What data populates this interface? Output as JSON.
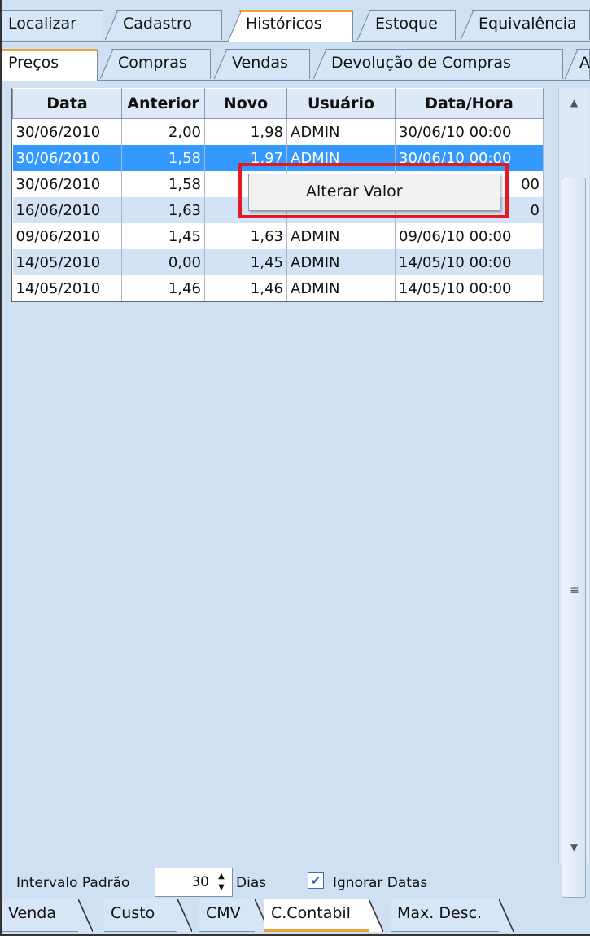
{
  "top_tabs": [
    "Localizar",
    "Cadastro",
    "Históricos",
    "Estoque",
    "Equivalência"
  ],
  "active_top_tab": "Históricos",
  "sub_tabs": [
    "Preços",
    "Compras",
    "Vendas",
    "Devolução de Compras",
    "A"
  ],
  "active_sub_tab": "Preços",
  "table": {
    "headers": [
      "Data",
      "Anterior",
      "Novo",
      "Usuário",
      "Data/Hora"
    ],
    "rows": [
      [
        "30/06/2010",
        "2,00",
        "1,98",
        "ADMIN",
        "30/06/10 00:00"
      ],
      [
        "30/06/2010",
        "1,58",
        "1,97",
        "ADMIN",
        "30/06/10 00:00"
      ],
      [
        "30/06/2010",
        "1,58",
        "",
        "",
        "00"
      ],
      [
        "16/06/2010",
        "1,63",
        "",
        "",
        "0"
      ],
      [
        "09/06/2010",
        "1,45",
        "1,63",
        "ADMIN",
        "09/06/10 00:00"
      ],
      [
        "14/05/2010",
        "0,00",
        "1,45",
        "ADMIN",
        "14/05/10 00:00"
      ],
      [
        "14/05/2010",
        "1,46",
        "1,46",
        "ADMIN",
        "14/05/10 00:00"
      ]
    ],
    "selected_row": 1
  },
  "context_menu": {
    "items": [
      "Alterar Valor"
    ]
  },
  "scrollbar": {
    "up_icon": "triangle-up-icon",
    "down_icon": "triangle-down-icon",
    "grip_icon": "grip-icon"
  },
  "controls": {
    "intervalo_label": "Intervalo Padrão",
    "intervalo_value": "30",
    "dias_label": "Dias",
    "ignorar_datas_label": "Ignorar Datas",
    "ignorar_datas_checked": true
  },
  "bottom_tabs": [
    "Venda",
    "Custo",
    "CMV",
    "C.Contabil",
    "Max. Desc."
  ],
  "active_bottom_tab": "C.Contabil",
  "colors": {
    "selection": "#3399ff",
    "highlight_box": "#e21b23",
    "active_tab_accent": "#f0a23a",
    "panel_bg": "#cfe0f3"
  }
}
